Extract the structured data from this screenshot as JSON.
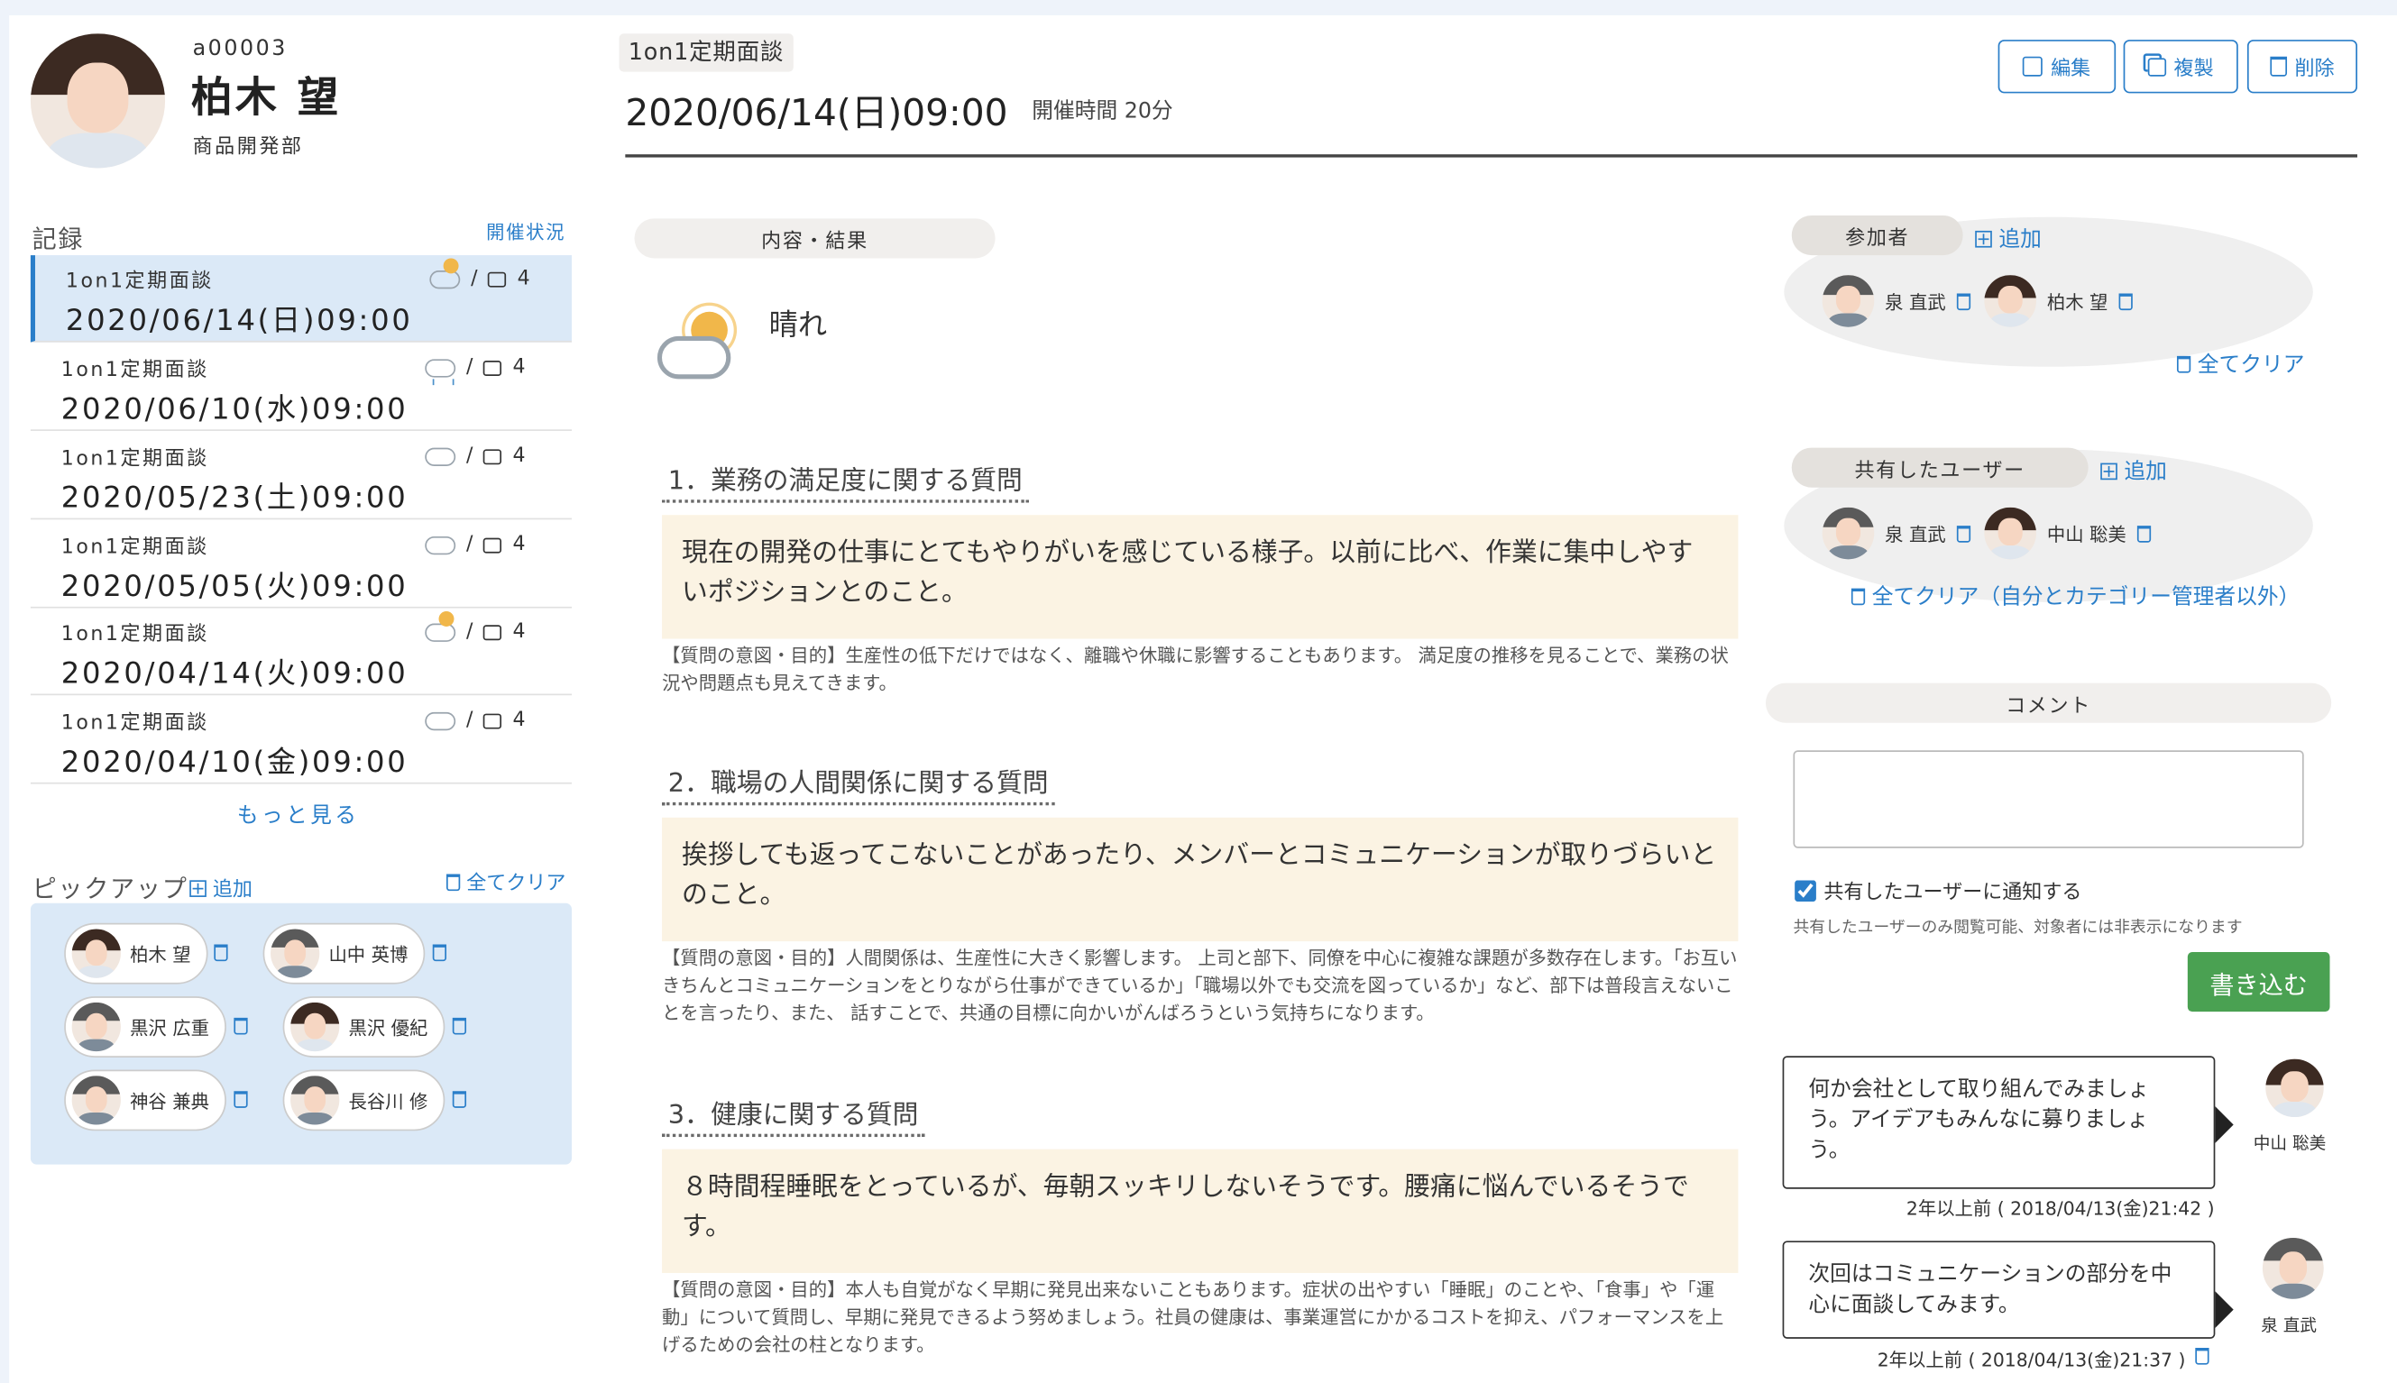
{
  "profile": {
    "id": "a00003",
    "name": "柏木 望",
    "department": "商品開発部"
  },
  "records": {
    "heading": "記録",
    "status_link": "開催状況",
    "items": [
      {
        "type": "1on1定期面談",
        "date": "2020/06/14(日)09:00",
        "weather": "sun-cloud",
        "comments": "4",
        "active": true
      },
      {
        "type": "1on1定期面談",
        "date": "2020/06/10(水)09:00",
        "weather": "rain",
        "comments": "4",
        "active": false
      },
      {
        "type": "1on1定期面談",
        "date": "2020/05/23(土)09:00",
        "weather": "cloud",
        "comments": "4",
        "active": false
      },
      {
        "type": "1on1定期面談",
        "date": "2020/05/05(火)09:00",
        "weather": "cloud",
        "comments": "4",
        "active": false
      },
      {
        "type": "1on1定期面談",
        "date": "2020/04/14(火)09:00",
        "weather": "sun-cloud",
        "comments": "4",
        "active": false
      },
      {
        "type": "1on1定期面談",
        "date": "2020/04/10(金)09:00",
        "weather": "cloud",
        "comments": "4",
        "active": false
      }
    ],
    "separator": "/",
    "more": "もっと見る"
  },
  "pickup": {
    "heading": "ピックアップ",
    "add": "追加",
    "clear_all": "全てクリア",
    "people": [
      "柏木 望",
      "山中 英博",
      "黒沢 広重",
      "黒沢 優紀",
      "神谷 兼典",
      "長谷川 修"
    ]
  },
  "header": {
    "badge": "1on1定期面談",
    "datetime": "2020/06/14(日)09:00",
    "duration": "開催時間 20分",
    "edit": "編集",
    "copy": "複製",
    "delete": "削除"
  },
  "content": {
    "section_title": "内容・結果",
    "weather_label": "晴れ",
    "questions": [
      {
        "title": "1．業務の満足度に関する質問",
        "answer": "現在の開発の仕事にとてもやりがいを感じている様子。以前に比べ、作業に集中しやすいポジションとのこと。",
        "note": "【質問の意図・目的】生産性の低下だけではなく、離職や休職に影響することもあります。 満足度の推移を見ることで、業務の状況や問題点も見えてきます。"
      },
      {
        "title": "2．職場の人間関係に関する質問",
        "answer": "挨拶しても返ってこないことがあったり、メンバーとコミュニケーションが取りづらいとのこと。",
        "note": "【質問の意図・目的】人間関係は、生産性に大きく影響します。 上司と部下、同僚を中心に複雑な課題が多数存在します。「お互いきちんとコミュニケーションをとりながら仕事ができているか」「職場以外でも交流を図っているか」など、部下は普段言えないことを言ったり、また、 話すことで、共通の目標に向かいがんばろうという気持ちになります。"
      },
      {
        "title": "3．健康に関する質問",
        "answer": "８時間程睡眠をとっているが、毎朝スッキリしないそうです。腰痛に悩んでいるそうです。",
        "note": "【質問の意図・目的】本人も自覚がなく早期に発見出来ないこともあります。症状の出やすい「睡眠」のことや、「食事」や「運動」について質問し、早期に発見できるよう努めましょう。社員の健康は、事業運営にかかるコストを抑え、パフォーマンスを上げるための会社の柱となります。"
      }
    ]
  },
  "participants": {
    "title": "参加者",
    "add": "追加",
    "people": [
      "泉 直武",
      "柏木 望"
    ],
    "clear_all": "全てクリア"
  },
  "shared_users": {
    "title": "共有したユーザー",
    "add": "追加",
    "people": [
      "泉 直武",
      "中山 聡美"
    ],
    "clear_all": "全てクリア（自分とカテゴリー管理者以外）"
  },
  "comment": {
    "title": "コメント",
    "textarea_value": "",
    "notify_label": "共有したユーザーに通知する",
    "notify_checked": true,
    "visibility_note": "共有したユーザーのみ閲覧可能、対象者には非表示になります",
    "submit": "書き込む",
    "items": [
      {
        "text": "何か会社として取り組んでみましょう。アイデアもみんなに募りましょう。",
        "author": "中山 聡美",
        "time": "2年以上前 ( 2018/04/13(金)21:42 )"
      },
      {
        "text": "次回はコミュニケーションの部分を中心に面談してみます。",
        "author": "泉 直武",
        "time": "2年以上前 ( 2018/04/13(金)21:37 )"
      }
    ]
  },
  "colors": {
    "accent": "#2a7ec9",
    "submit": "#4aa152",
    "answer_bg": "#fbf3e3",
    "active_row": "#dbe9f7"
  }
}
